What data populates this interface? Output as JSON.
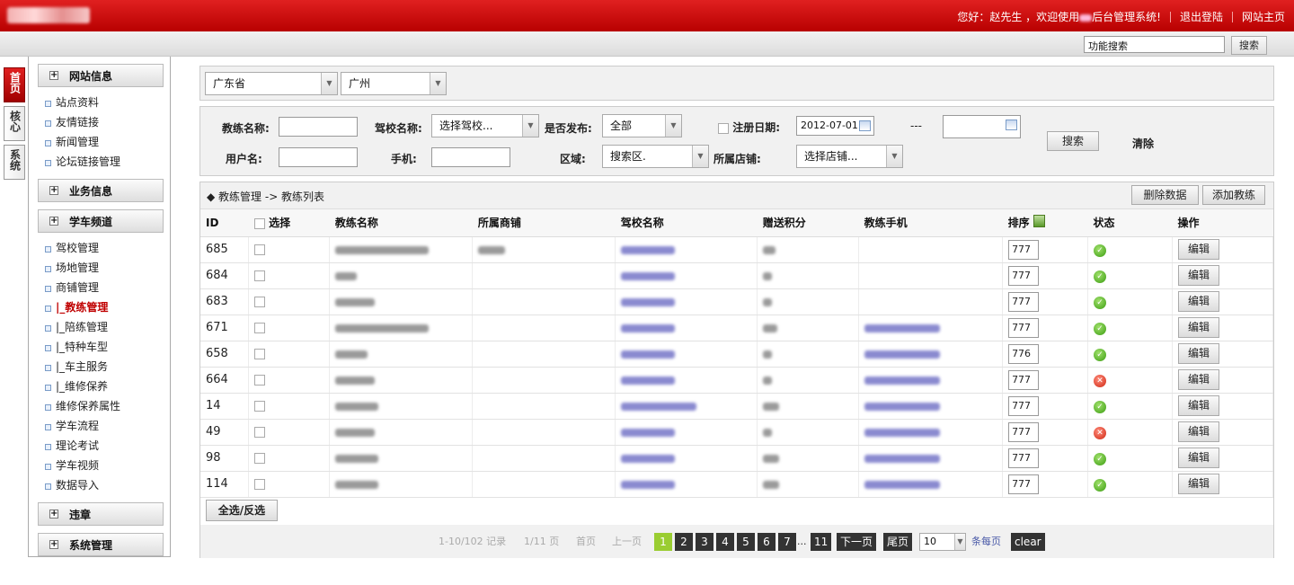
{
  "header": {
    "greeting": "您好：赵先生 ，欢迎使用",
    "greeting_tail": "后台管理系统!",
    "logout": "退出登陆",
    "home": "网站主页"
  },
  "function_search": {
    "value": "功能搜索",
    "button": "搜索"
  },
  "vertical_tabs": [
    "首页",
    "核心",
    "系统"
  ],
  "sidebar": {
    "site_info": "网站信息",
    "site_items": [
      "站点资料",
      "友情链接",
      "新闻管理",
      "论坛链接管理"
    ],
    "business": "业务信息",
    "learn_channel": "学车频道",
    "learn_items": [
      "驾校管理",
      "场地管理",
      "商铺管理",
      "|_教练管理",
      "|_陪练管理",
      "|_特种车型",
      "|_车主服务",
      "|_维修保养",
      "维修保养属性",
      "学车流程",
      "理论考试",
      "学车视频",
      "数据导入"
    ],
    "violation": "违章",
    "system": "系统管理"
  },
  "region": {
    "province": "广东省",
    "city": "广州"
  },
  "search": {
    "coach_name_label": "教练名称:",
    "school_label": "驾校名称:",
    "school_value": "选择驾校...",
    "published_label": "是否发布:",
    "published_value": "全部",
    "reg_date_label": "注册日期:",
    "date_from": "2012-07-01",
    "date_sep": "---",
    "search_btn": "搜索",
    "clear": "清除",
    "username_label": "用户名:",
    "phone_label": "手机:",
    "area_label": "区域:",
    "area_value": "搜索区.",
    "store_label": "所属店铺:",
    "store_value": "选择店铺..."
  },
  "list": {
    "breadcrumb": "◆ 教练管理 -> 教练列表",
    "delete_btn": "删除数据",
    "add_btn": "添加教练",
    "columns": [
      "ID",
      "选择",
      "教练名称",
      "所属商铺",
      "驾校名称",
      "赠送积分",
      "教练手机",
      "排序",
      "状态",
      "操作"
    ],
    "edit_label": "编辑",
    "rows": [
      {
        "id": "685",
        "sort": "777",
        "status": "ok"
      },
      {
        "id": "684",
        "sort": "777",
        "status": "ok"
      },
      {
        "id": "683",
        "sort": "777",
        "status": "ok"
      },
      {
        "id": "671",
        "sort": "777",
        "status": "ok"
      },
      {
        "id": "658",
        "sort": "776",
        "status": "ok"
      },
      {
        "id": "664",
        "sort": "777",
        "status": "no"
      },
      {
        "id": "14",
        "sort": "777",
        "status": "ok"
      },
      {
        "id": "49",
        "sort": "777",
        "status": "no"
      },
      {
        "id": "98",
        "sort": "777",
        "status": "ok"
      },
      {
        "id": "114",
        "sort": "777",
        "status": "ok"
      }
    ],
    "select_all": "全选/反选"
  },
  "pager": {
    "records": "1-10/102 记录",
    "pages": "1/11 页",
    "first": "首页",
    "prev": "上一页",
    "numbers": [
      "1",
      "2",
      "3",
      "4",
      "5",
      "6",
      "7"
    ],
    "ellipsis": "...",
    "last_num": "11",
    "next": "下一页",
    "last": "尾页",
    "per_page": "10",
    "per_page_label": "条每页",
    "clear": "clear"
  },
  "colors": {
    "brand_red": "#cc0000",
    "status_ok": "#3c9d12",
    "status_no": "#cf2a14",
    "pager_current": "#9acd32"
  }
}
